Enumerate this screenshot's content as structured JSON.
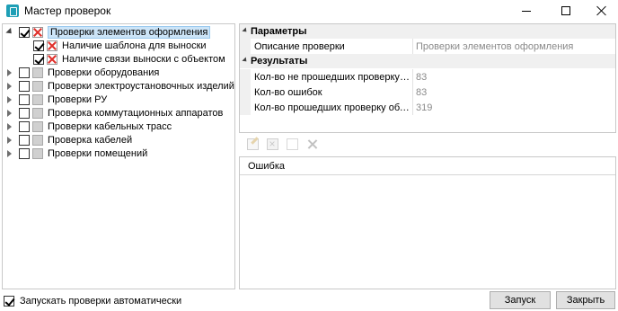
{
  "window": {
    "title": "Мастер проверок"
  },
  "tree": {
    "items": [
      {
        "label": "Проверки элементов оформления",
        "level": 0,
        "expanded": true,
        "checked": true,
        "status": "error",
        "selected": true
      },
      {
        "label": "Наличие шаблона для выноски",
        "level": 1,
        "expanded": false,
        "checked": true,
        "status": "error",
        "selected": false
      },
      {
        "label": "Наличие связи выноски с объектом",
        "level": 1,
        "expanded": false,
        "checked": true,
        "status": "error",
        "selected": false
      },
      {
        "label": "Проверки оборудования",
        "level": 0,
        "expanded": false,
        "checked": false,
        "status": "none",
        "selected": false
      },
      {
        "label": "Проверки электроустановочных изделий",
        "level": 0,
        "expanded": false,
        "checked": false,
        "status": "none",
        "selected": false
      },
      {
        "label": "Проверки РУ",
        "level": 0,
        "expanded": false,
        "checked": false,
        "status": "none",
        "selected": false
      },
      {
        "label": "Проверка коммутационных аппаратов",
        "level": 0,
        "expanded": false,
        "checked": false,
        "status": "none",
        "selected": false
      },
      {
        "label": "Проверки кабельных трасс",
        "level": 0,
        "expanded": false,
        "checked": false,
        "status": "none",
        "selected": false
      },
      {
        "label": "Проверка кабелей",
        "level": 0,
        "expanded": false,
        "checked": false,
        "status": "none",
        "selected": false
      },
      {
        "label": "Проверки помещений",
        "level": 0,
        "expanded": false,
        "checked": false,
        "status": "none",
        "selected": false
      }
    ]
  },
  "properties": {
    "params": {
      "category": "Параметры",
      "rows": [
        {
          "name": "Описание проверки",
          "value": "Проверки элементов оформления"
        }
      ]
    },
    "results": {
      "category": "Результаты",
      "rows": [
        {
          "name": "Кол-во не прошедших проверку об...",
          "value": "83"
        },
        {
          "name": "Кол-во ошибок",
          "value": "83"
        },
        {
          "name": "Кол-во прошедших проверку объек...",
          "value": "319"
        }
      ]
    }
  },
  "toolbar": {
    "icons": [
      "edit-icon",
      "mark-icon",
      "document-icon",
      "tools-icon"
    ]
  },
  "errors": {
    "column_header": "Ошибка"
  },
  "footer": {
    "auto_run_label": "Запускать проверки автоматически",
    "auto_run_checked": true,
    "run_button": "Запуск",
    "close_button": "Закрыть"
  },
  "colors": {
    "selection": "#cce4f7",
    "error_mark": "#e0302b",
    "category_bg": "#f0f0f0"
  }
}
